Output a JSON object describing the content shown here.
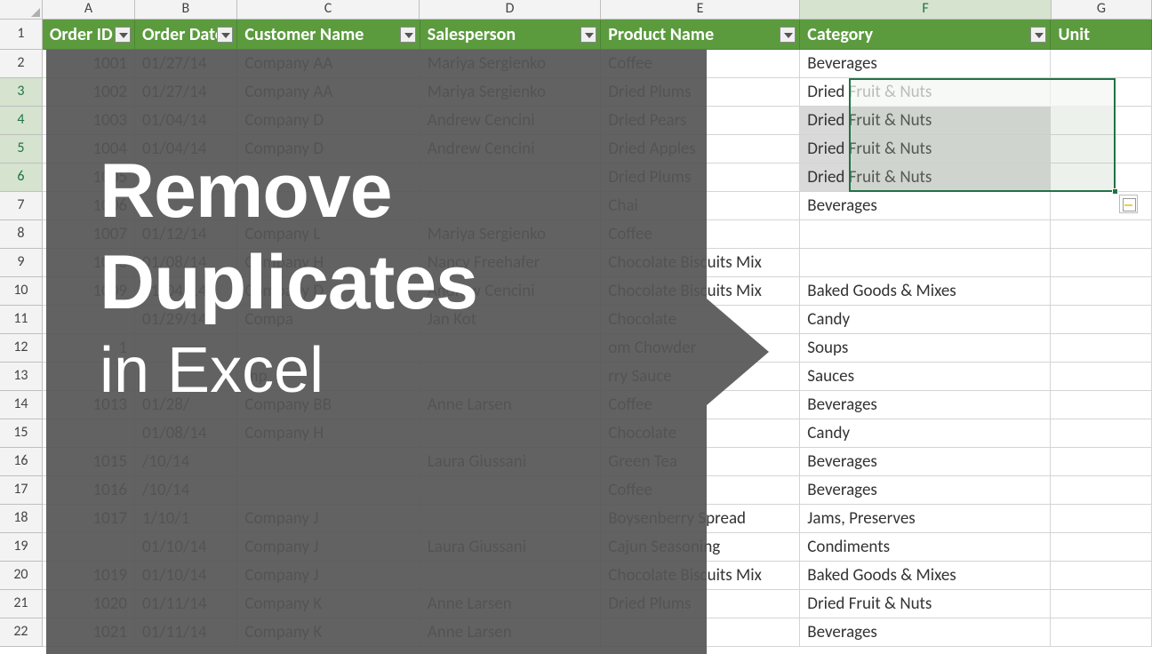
{
  "columns": [
    "A",
    "B",
    "C",
    "D",
    "E",
    "F",
    "G"
  ],
  "headers": {
    "A": "Order ID",
    "B": "Order Date",
    "C": "Customer Name",
    "D": "Salesperson",
    "E": "Product Name",
    "F": "Category",
    "G": "Unit"
  },
  "rows": [
    {
      "n": 2,
      "A": "1001",
      "B": "01/27/14",
      "C": "Company AA",
      "D": "Mariya Sergienko",
      "E": "Coffee",
      "F": "Beverages"
    },
    {
      "n": 3,
      "A": "1002",
      "B": "01/27/14",
      "C": "Company AA",
      "D": "Mariya Sergienko",
      "E": "Dried Plums",
      "F": "Dried Fruit & Nuts"
    },
    {
      "n": 4,
      "A": "1003",
      "B": "01/04/14",
      "C": "Company D",
      "D": "Andrew Cencini",
      "E": "Dried Pears",
      "F": "Dried Fruit & Nuts"
    },
    {
      "n": 5,
      "A": "1004",
      "B": "01/04/14",
      "C": "Company D",
      "D": "Andrew Cencini",
      "E": "Dried Apples",
      "F": "Dried Fruit & Nuts"
    },
    {
      "n": 6,
      "A": "1005",
      "B": "",
      "C": "",
      "D": "",
      "E": "Dried Plums",
      "F": "Dried Fruit & Nuts"
    },
    {
      "n": 7,
      "A": "1006",
      "B": "",
      "C": "",
      "D": "",
      "E": "Chai",
      "F": "Beverages"
    },
    {
      "n": 8,
      "A": "1007",
      "B": "01/12/14",
      "C": "Company L",
      "D": "Mariya Sergienko",
      "E": "Coffee",
      "F": ""
    },
    {
      "n": 9,
      "A": "1008",
      "B": "01/08/14",
      "C": "Company H",
      "D": "Nancy Freehafer",
      "E": "Chocolate Biscuits Mix",
      "F": ""
    },
    {
      "n": 10,
      "A": "1009",
      "B": "01/04/14",
      "C": "Company D",
      "D": "Andrew Cencini",
      "E": "Chocolate Biscuits Mix",
      "F": "Baked Goods & Mixes"
    },
    {
      "n": 11,
      "A": "",
      "B": "01/29/14",
      "C": "Compa",
      "D": "Jan Kot",
      "E": "Chocolate",
      "F": "Candy"
    },
    {
      "n": 12,
      "A": "1",
      "B": "",
      "C": "",
      "D": "",
      "E": "om Chowder",
      "F": "Soups"
    },
    {
      "n": 13,
      "A": "",
      "B": "",
      "C": "mp",
      "D": "",
      "E": "rry Sauce",
      "F": "Sauces"
    },
    {
      "n": 14,
      "A": "1013",
      "B": "01/28/",
      "C": "Company BB",
      "D": "Anne Larsen",
      "E": "Coffee",
      "F": "Beverages"
    },
    {
      "n": 15,
      "A": "",
      "B": "01/08/14",
      "C": "Company H",
      "D": "",
      "E": "Chocolate",
      "F": "Candy"
    },
    {
      "n": 16,
      "A": "1015",
      "B": "/10/14",
      "C": "",
      "D": "Laura Giussani",
      "E": "Green Tea",
      "F": "Beverages"
    },
    {
      "n": 17,
      "A": "1016",
      "B": "/10/14",
      "C": "",
      "D": "",
      "E": "Coffee",
      "F": "Beverages"
    },
    {
      "n": 18,
      "A": "1017",
      "B": "1/10/1",
      "C": "Company J",
      "D": "",
      "E": "Boysenberry Spread",
      "F": "Jams, Preserves"
    },
    {
      "n": 19,
      "A": "",
      "B": "01/10/14",
      "C": "Company J",
      "D": "Laura Giussani",
      "E": "Cajun Seasoning",
      "F": "Condiments"
    },
    {
      "n": 20,
      "A": "1019",
      "B": "01/10/14",
      "C": "Company J",
      "D": "",
      "E": "Chocolate Biscuits Mix",
      "F": "Baked Goods & Mixes"
    },
    {
      "n": 21,
      "A": "1020",
      "B": "01/11/14",
      "C": "Company K",
      "D": "Anne Larsen",
      "E": "Dried Plums",
      "F": "Dried Fruit & Nuts"
    },
    {
      "n": 22,
      "A": "1021",
      "B": "01/11/14",
      "C": "Company K",
      "D": "Anne Larsen",
      "E": "",
      "F": "Beverages"
    }
  ],
  "overlay": {
    "line1": "Remove",
    "line2": "Duplicates",
    "line3": "in Excel"
  },
  "selection": {
    "colStart": "F",
    "rowStart": 3,
    "rowEnd": 6
  },
  "colors": {
    "header_bg": "#5b9b3e",
    "selection": "#217346"
  }
}
